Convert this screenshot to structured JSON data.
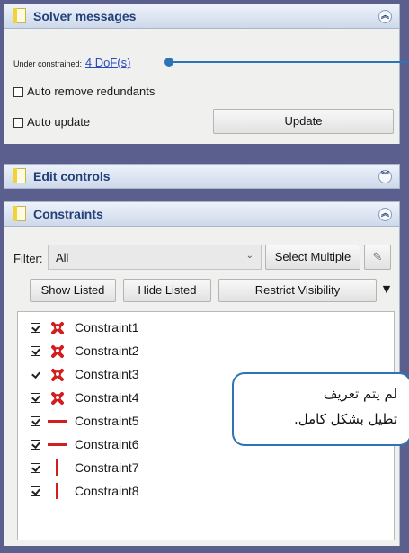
{
  "solver": {
    "title": "Solver messages",
    "status_label": "Under constrained:",
    "status_link": "4 DoF(s)",
    "auto_remove": "Auto remove redundants",
    "auto_update": "Auto update",
    "update_button": "Update"
  },
  "edit_controls": {
    "title": "Edit controls"
  },
  "constraints": {
    "title": "Constraints",
    "filter_label": "Filter:",
    "filter_value": "All",
    "select_multiple": "Select Multiple",
    "show_listed": "Show Listed",
    "hide_listed": "Hide Listed",
    "restrict_visibility": "Restrict Visibility",
    "items": [
      {
        "label": "Constraint1",
        "icon": "coincident-x-icon"
      },
      {
        "label": "Constraint2",
        "icon": "coincident-x-icon"
      },
      {
        "label": "Constraint3",
        "icon": "coincident-x-icon"
      },
      {
        "label": "Constraint4",
        "icon": "coincident-x-icon"
      },
      {
        "label": "Constraint5",
        "icon": "horizontal-icon"
      },
      {
        "label": "Constraint6",
        "icon": "horizontal-icon"
      },
      {
        "label": "Constraint7",
        "icon": "vertical-icon"
      },
      {
        "label": "Constraint8",
        "icon": "vertical-icon"
      }
    ]
  },
  "callout": {
    "line1": "لم يتم تعريف",
    "line2": "تطيل بشكل كامل."
  },
  "colors": {
    "accent": "#2c74b6",
    "header_text": "#23407a",
    "constraint_red": "#d21e1e"
  }
}
